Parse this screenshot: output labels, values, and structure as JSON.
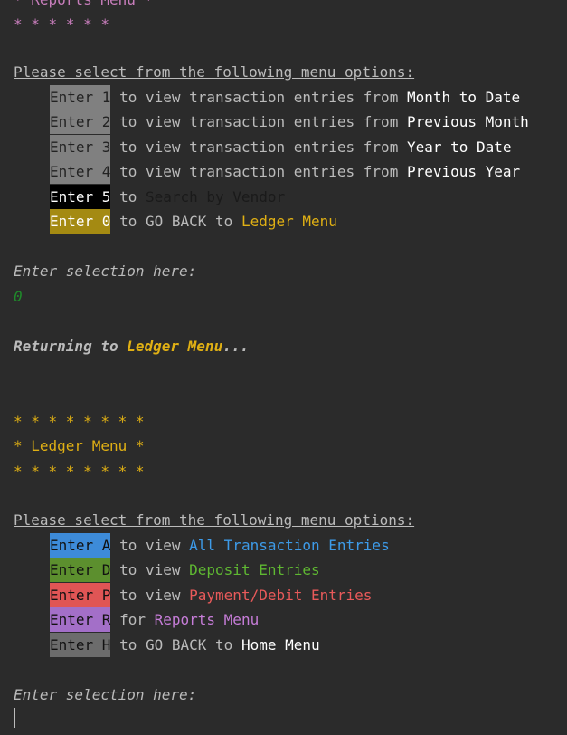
{
  "reports_header": {
    "title_line": "* Reports Menu *",
    "stars_line": "* * * * * *"
  },
  "reports_prompt": "Please select from the following menu options:",
  "reports_options": [
    {
      "key": "Enter 1",
      "text": " to view transaction entries from ",
      "target": "Month to Date"
    },
    {
      "key": "Enter 2",
      "text": " to view transaction entries from ",
      "target": "Previous Month"
    },
    {
      "key": "Enter 3",
      "text": " to view transaction entries from ",
      "target": "Year to Date"
    },
    {
      "key": "Enter 4",
      "text": " to view transaction entries from ",
      "target": "Previous Year"
    },
    {
      "key": "Enter 5",
      "text": " to ",
      "target": "Search by Vendor"
    },
    {
      "key": "Enter 0",
      "text": " to GO BACK to ",
      "target": "Ledger Menu"
    }
  ],
  "selection_prompt_1": "Enter selection here:",
  "user_input_1": "0",
  "returning": {
    "prefix": "Returning to ",
    "target": "Ledger Menu",
    "suffix": "..."
  },
  "ledger_header": {
    "stars_top": "* * * * * * * *",
    "title_line": "* Ledger Menu *",
    "stars_bottom": "* * * * * * * *"
  },
  "ledger_prompt": "Please select from the following menu options:",
  "ledger_options": [
    {
      "key": "Enter A",
      "text": " to view ",
      "target": "All Transaction Entries"
    },
    {
      "key": "Enter D",
      "text": " to view ",
      "target": "Deposit Entries"
    },
    {
      "key": "Enter P",
      "text": " to view ",
      "target": "Payment/Debit Entries"
    },
    {
      "key": "Enter R",
      "text": " for ",
      "target": "Reports Menu"
    },
    {
      "key": "Enter H",
      "text": " to GO BACK to ",
      "target": "Home Menu"
    }
  ],
  "selection_prompt_2": "Enter selection here:"
}
